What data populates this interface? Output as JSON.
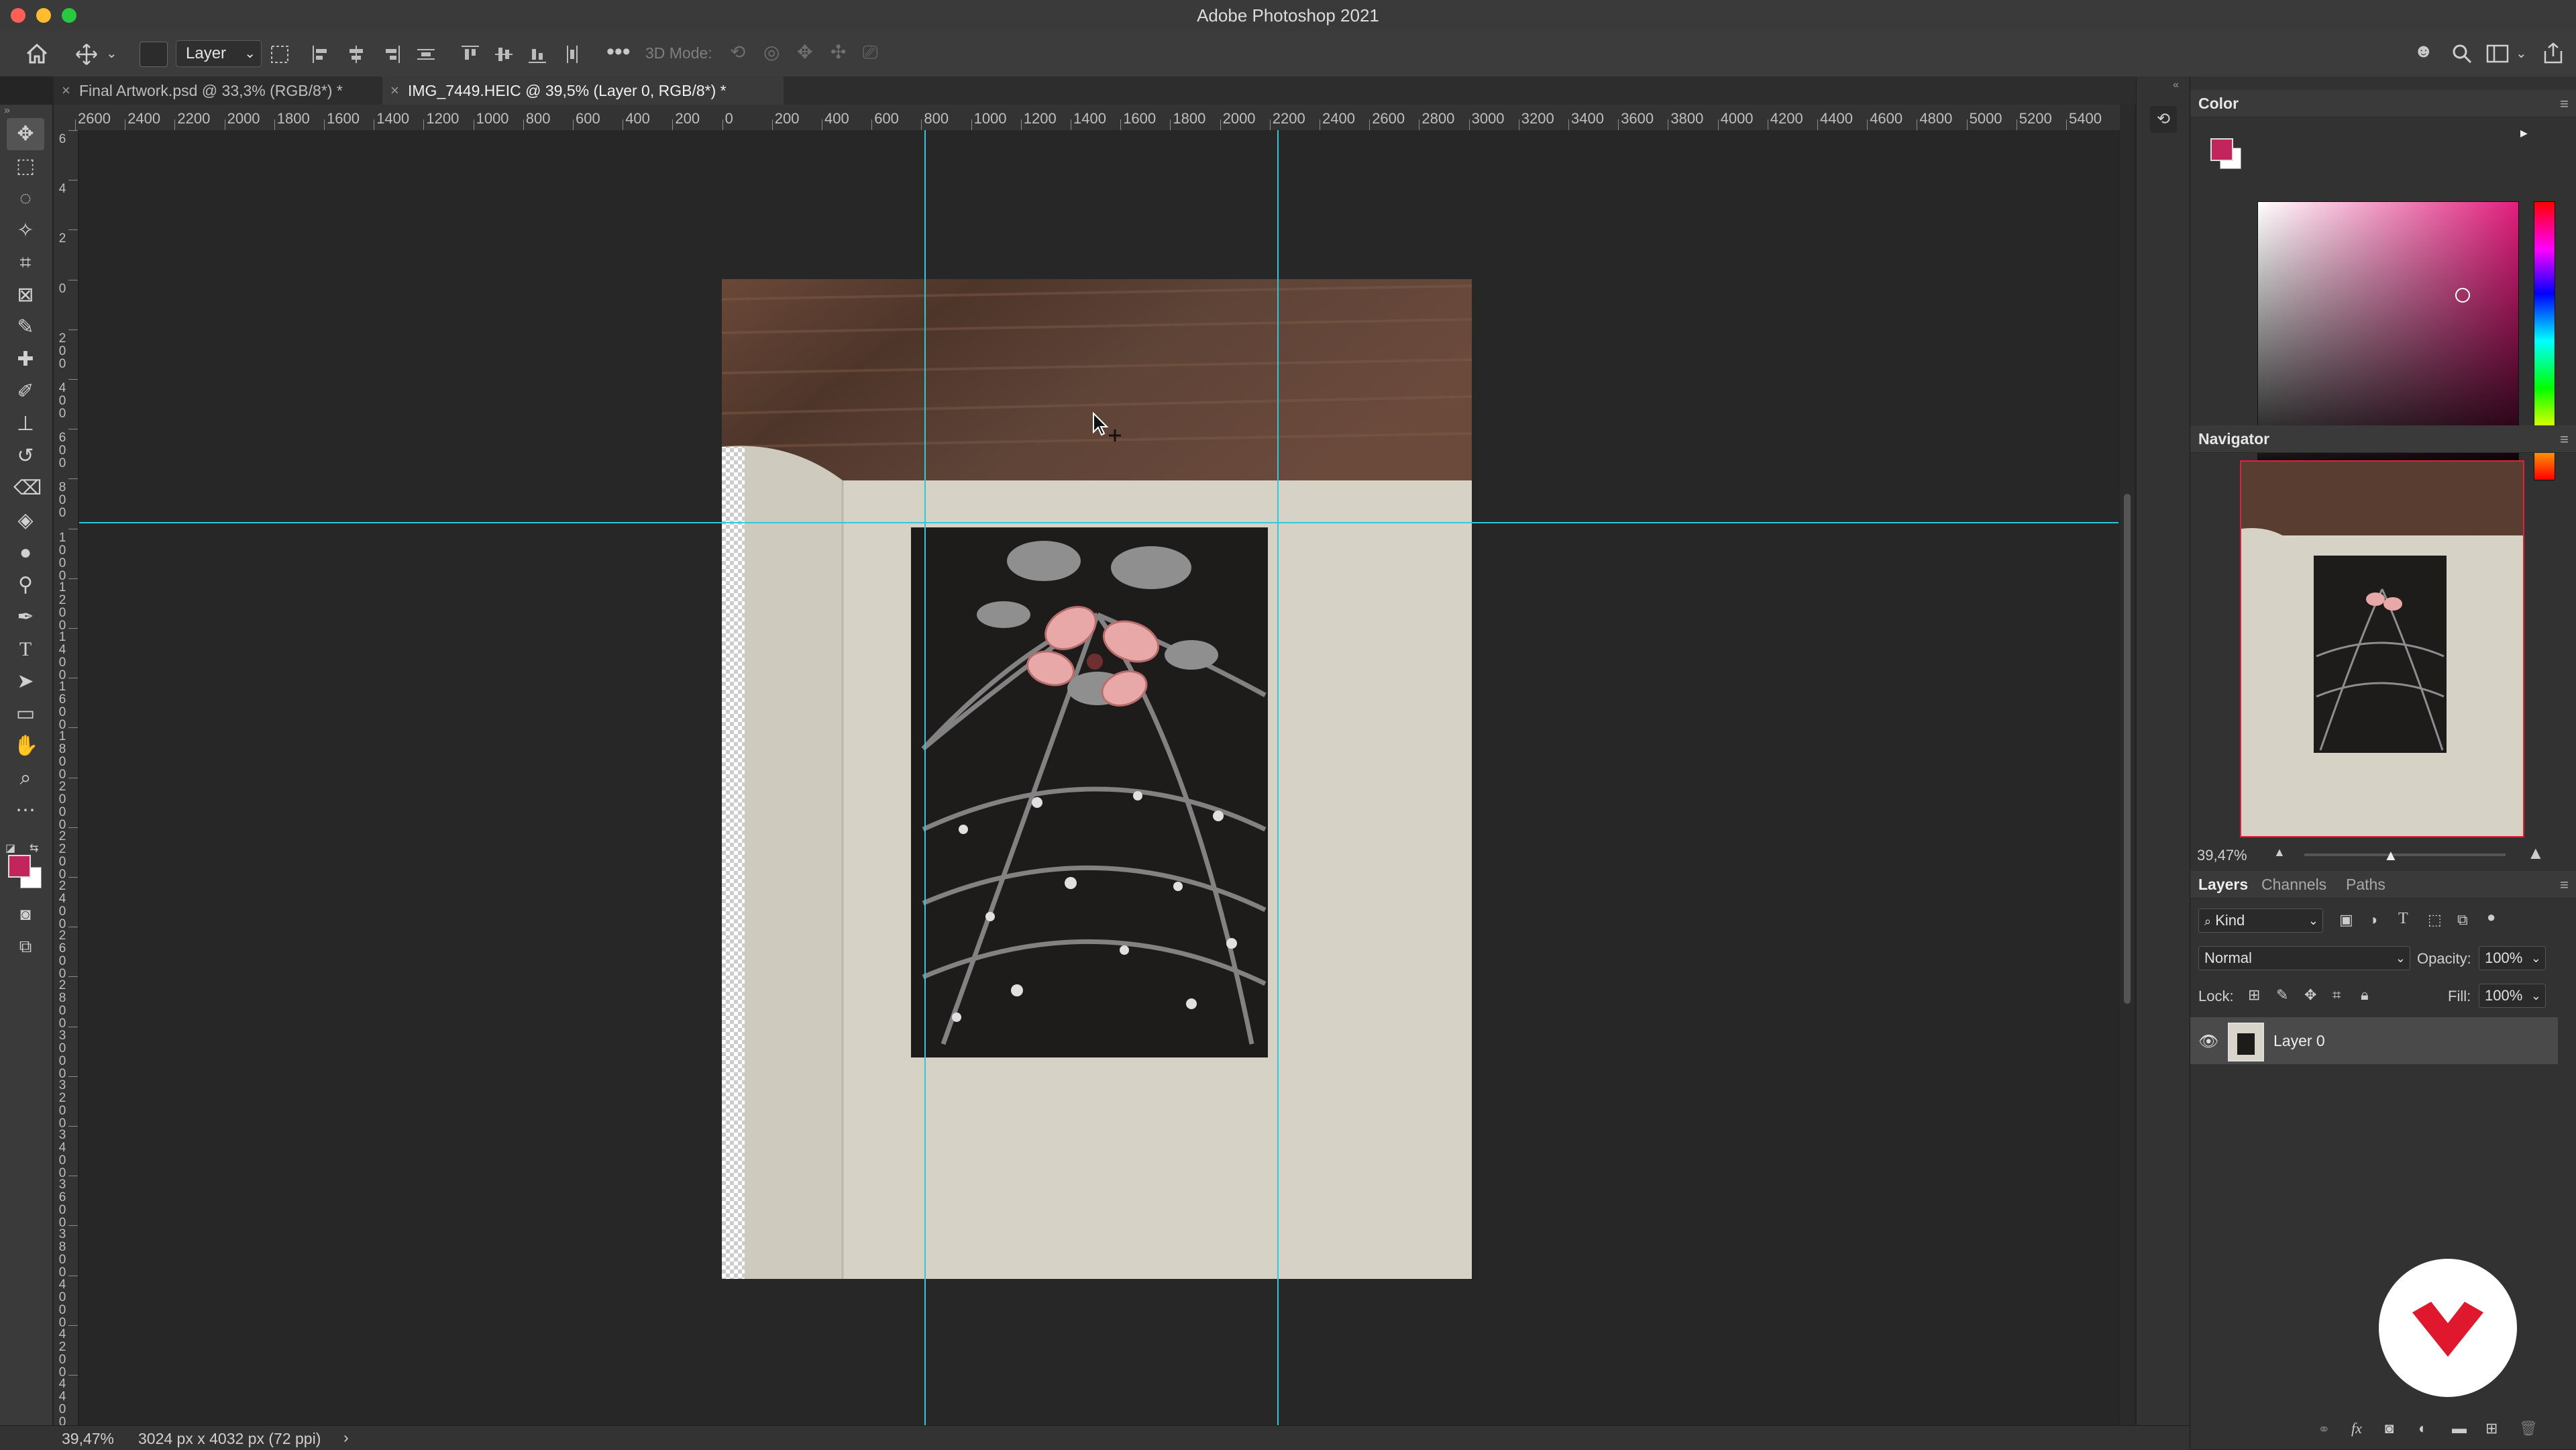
{
  "window": {
    "title": "Adobe Photoshop 2021"
  },
  "colors": {
    "accent": "#36c6d9",
    "foreground": "#c2255c",
    "background": "#ffffff",
    "brand": "#e0182d"
  },
  "options_bar": {
    "auto_select_target": "Layer",
    "mode_3d_label": "3D Mode:"
  },
  "tabs": [
    {
      "label": "Final Artwork.psd @ 33,3% (RGB/8*) *"
    },
    {
      "label": "IMG_7449.HEIC @ 39,5% (Layer 0, RGB/8*) *"
    }
  ],
  "ruler": {
    "horizontal": [
      "2600",
      "2400",
      "2200",
      "2000",
      "1800",
      "1600",
      "1400",
      "1200",
      "1000",
      "800",
      "600",
      "400",
      "200",
      "0",
      "200",
      "400",
      "600",
      "800",
      "1000",
      "1200",
      "1400",
      "1600",
      "1800",
      "2000",
      "2200",
      "2400",
      "2600",
      "2800",
      "3000",
      "3200",
      "3400",
      "3600",
      "3800",
      "4000",
      "4200",
      "4400",
      "4600",
      "4800",
      "5000",
      "5200",
      "5400"
    ],
    "vertical": [
      {
        "d": [
          "6"
        ]
      },
      {
        "d": [
          "4"
        ]
      },
      {
        "d": [
          "2"
        ]
      },
      {
        "d": [
          "0"
        ]
      },
      {
        "d": [
          "2",
          "0",
          "0"
        ]
      },
      {
        "d": [
          "4",
          "0",
          "0"
        ]
      },
      {
        "d": [
          "6",
          "0",
          "0"
        ]
      },
      {
        "d": [
          "8",
          "0",
          "0"
        ]
      },
      {
        "d": [
          "1",
          "0",
          "0",
          "0"
        ]
      },
      {
        "d": [
          "1",
          "2",
          "0",
          "0"
        ]
      },
      {
        "d": [
          "1",
          "4",
          "0",
          "0"
        ]
      },
      {
        "d": [
          "1",
          "6",
          "0",
          "0"
        ]
      },
      {
        "d": [
          "1",
          "8",
          "0",
          "0"
        ]
      },
      {
        "d": [
          "2",
          "0",
          "0",
          "0"
        ]
      },
      {
        "d": [
          "2",
          "2",
          "0",
          "0"
        ]
      },
      {
        "d": [
          "2",
          "4",
          "0",
          "0"
        ]
      },
      {
        "d": [
          "2",
          "6",
          "0",
          "0"
        ]
      },
      {
        "d": [
          "2",
          "8",
          "0",
          "0"
        ]
      },
      {
        "d": [
          "3",
          "0",
          "0",
          "0"
        ]
      },
      {
        "d": [
          "3",
          "2",
          "0",
          "0"
        ]
      },
      {
        "d": [
          "3",
          "4",
          "0",
          "0"
        ]
      },
      {
        "d": [
          "3",
          "6",
          "0",
          "0"
        ]
      },
      {
        "d": [
          "3",
          "8",
          "0",
          "0"
        ]
      },
      {
        "d": [
          "4",
          "0",
          "0",
          "0"
        ]
      },
      {
        "d": [
          "4",
          "2",
          "0",
          "0"
        ]
      },
      {
        "d": [
          "4",
          "4",
          "0",
          "0"
        ]
      }
    ]
  },
  "status": {
    "zoom": "39,47%",
    "doc_info": "3024 px x 4032 px (72 ppi)",
    "arrow": "›"
  },
  "panels": {
    "color": {
      "title": "Color"
    },
    "navigator": {
      "title": "Navigator",
      "zoom": "39,47%"
    },
    "layers": {
      "tabs": [
        "Layers",
        "Channels",
        "Paths"
      ],
      "filter_kind": "Kind",
      "blend_mode": "Normal",
      "opacity_label": "Opacity:",
      "opacity_value": "100%",
      "lock_label": "Lock:",
      "fill_label": "Fill:",
      "fill_value": "100%",
      "layer_name": "Layer 0"
    }
  }
}
